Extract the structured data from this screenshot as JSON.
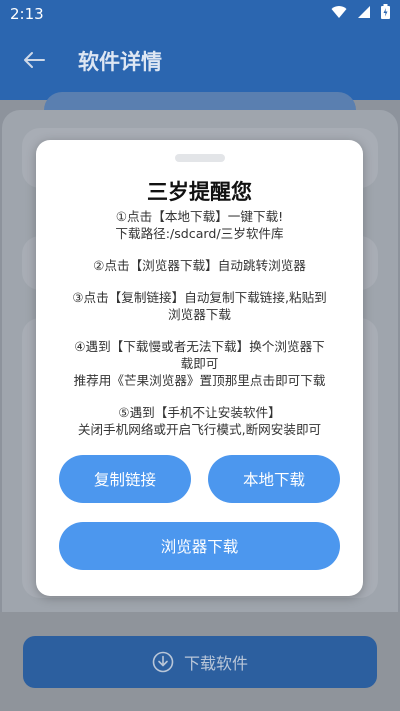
{
  "status_bar": {
    "time": "2:13"
  },
  "appbar": {
    "title": "软件详情"
  },
  "dialog": {
    "title": "三岁提醒您",
    "paragraphs": [
      [
        "①点击【本地下载】一键下载!",
        "下载路径:/sdcard/三岁软件库"
      ],
      [
        "②点击【浏览器下载】自动跳转浏览器"
      ],
      [
        "③点击【复制链接】自动复制下载链接,粘贴到",
        "浏览器下载"
      ],
      [
        "④遇到【下载慢或者无法下载】换个浏览器下",
        "载即可",
        "推荐用《芒果浏览器》置顶那里点击即可下载"
      ],
      [
        "⑤遇到【手机不让安装软件】",
        "关闭手机网络或开启飞行模式,断网安装即可"
      ]
    ],
    "buttons": {
      "copy_link": "复制链接",
      "local_download": "本地下载",
      "browser_download": "浏览器下载"
    }
  },
  "bottom": {
    "download_label": "下载软件"
  },
  "colors": {
    "primary_button": "#4c97ee",
    "appbar": "#2b66b0"
  }
}
